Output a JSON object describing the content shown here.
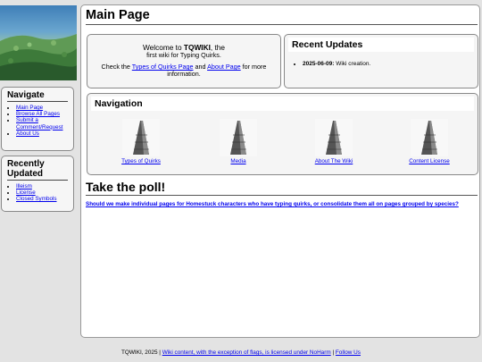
{
  "page": {
    "title": "Main Page"
  },
  "sidebar": {
    "navigate_heading": "Navigate",
    "navigate_items": [
      "Main Page",
      "Browse All Pages",
      "Submit a Comment/Request",
      "About Us"
    ],
    "recent_heading": "Recently Updated",
    "recent_items": [
      "Illeism",
      "License",
      "Closed Symbols"
    ]
  },
  "welcome": {
    "line1_prefix": "Welcome to ",
    "site_name": "TQWIKI",
    "line1_suffix": ", the",
    "line2": "first wiki for Typing Quirks.",
    "line3_prefix": "Check the ",
    "link_types": "Types of Quirks Page",
    "line3_mid": " and ",
    "link_about": "About Page",
    "line3_suffix": " for more information."
  },
  "updates": {
    "heading": "Recent Updates",
    "items": [
      {
        "date": "2025-06-09:",
        "text": " Wiki creation."
      }
    ]
  },
  "navigation": {
    "heading": "Navigation",
    "items": [
      "Types of Quirks",
      "Media",
      "About The Wiki",
      "Content License"
    ]
  },
  "poll": {
    "heading": "Take the poll!",
    "question": "Should we make individual pages for Homestuck characters who have typing quirks, or consolidate them all on pages grouped by species?"
  },
  "footer": {
    "prefix": "TQWIKI, 2025 | ",
    "license_link": "Wiki content, with the exception of flags, is licensed under NoHarm",
    "separator": " | ",
    "follow_link": "Follow Us"
  }
}
